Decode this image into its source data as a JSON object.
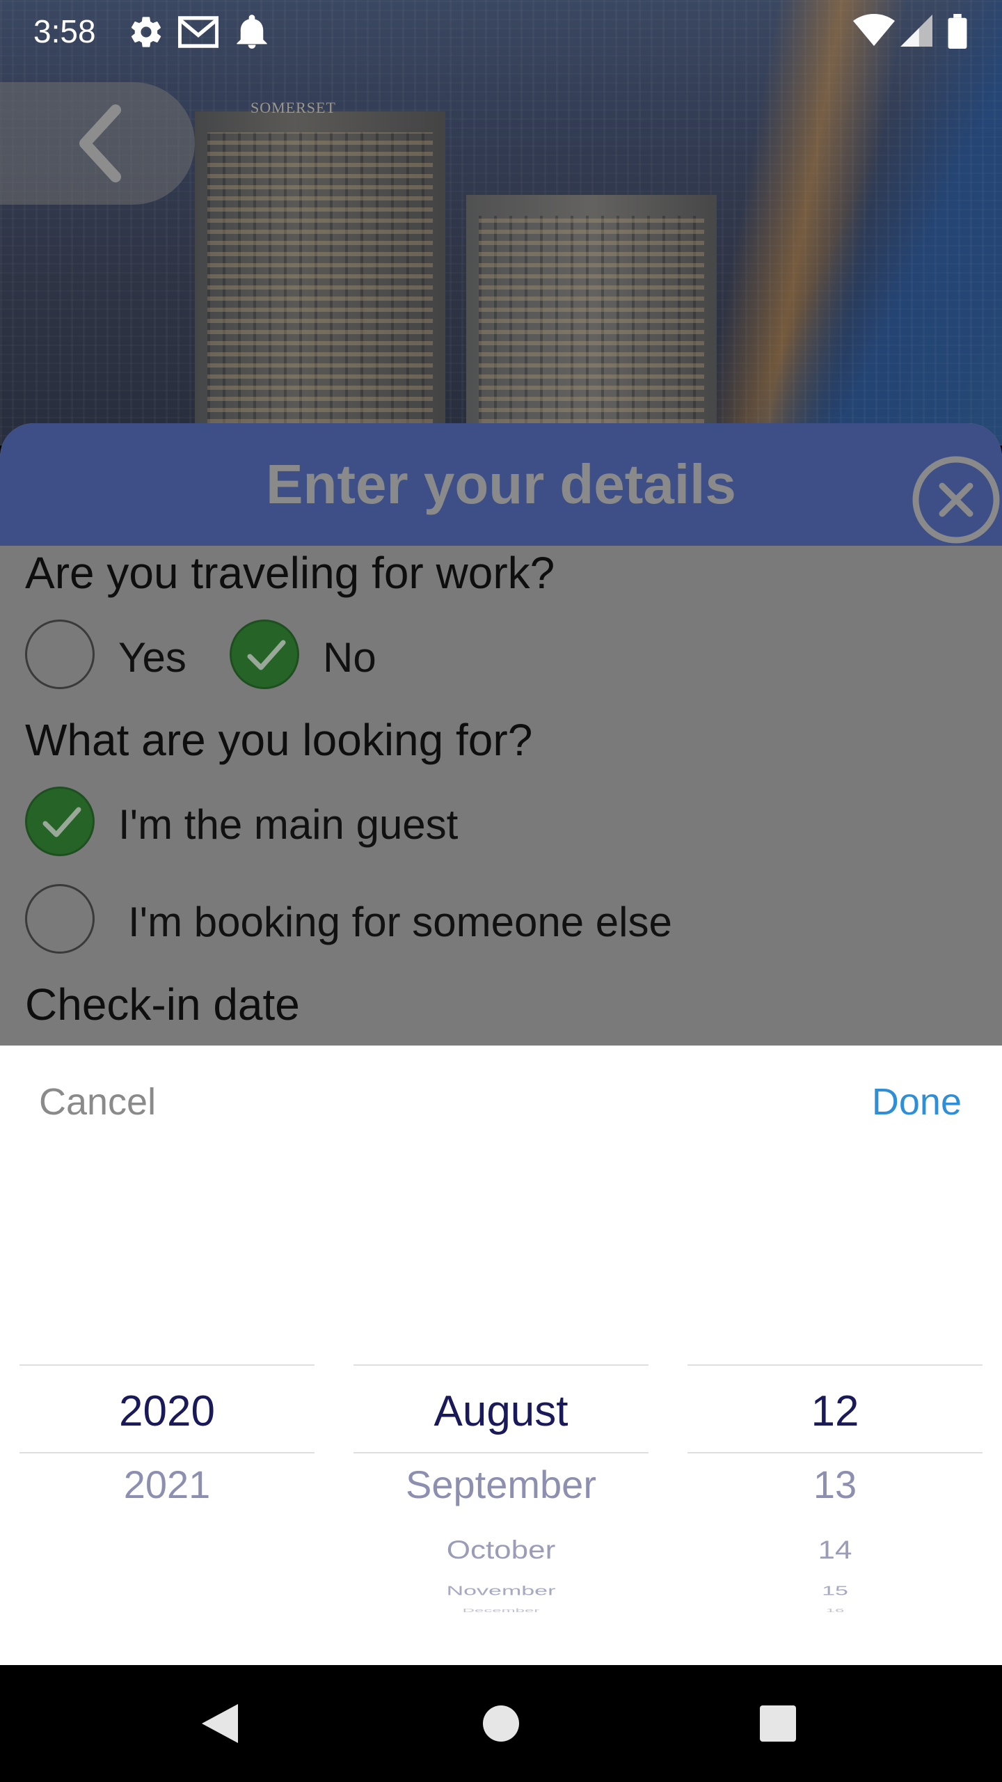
{
  "status_bar": {
    "time": "3:58",
    "icons": [
      "gear-icon",
      "gmail-icon",
      "bell-icon",
      "wifi-icon",
      "signal-icon",
      "battery-icon"
    ]
  },
  "hero": {
    "sign_text": "SOMERSET"
  },
  "sheet": {
    "title": "Enter your details",
    "work_question": "Are you traveling for work?",
    "work_options": [
      {
        "label": "Yes",
        "checked": false
      },
      {
        "label": "No",
        "checked": true
      }
    ],
    "looking_question": "What are you looking for?",
    "looking_options": [
      {
        "label": "I'm the main guest",
        "checked": true
      },
      {
        "label": "I'm booking for someone else",
        "checked": false
      }
    ],
    "checkin_label": "Check-in date"
  },
  "picker": {
    "cancel_label": "Cancel",
    "done_label": "Done",
    "year": {
      "selected": "2020",
      "next": [
        "2021"
      ]
    },
    "month": {
      "selected": "August",
      "next": [
        "September",
        "October",
        "November",
        "December"
      ]
    },
    "day": {
      "selected": "12",
      "next": [
        "13",
        "14",
        "15",
        "16"
      ]
    }
  },
  "colors": {
    "header_bg": "#3d4f86",
    "check_green": "#256426",
    "done_blue": "#2e8fd8",
    "picker_selected": "#1a1a5a"
  }
}
